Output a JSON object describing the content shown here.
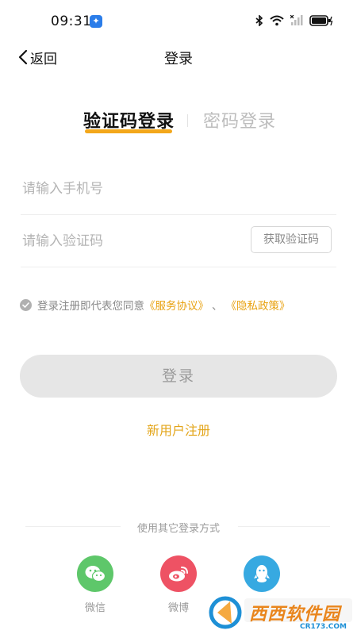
{
  "status_bar": {
    "time": "09:31"
  },
  "header": {
    "back_label": "返回",
    "title": "登录"
  },
  "tabs": [
    {
      "label": "验证码登录",
      "active": true
    },
    {
      "label": "密码登录",
      "active": false
    }
  ],
  "form": {
    "phone_placeholder": "请输入手机号",
    "code_placeholder": "请输入验证码",
    "get_code_label": "获取验证码"
  },
  "agreement": {
    "prefix": "登录注册即代表您同意",
    "service_link": "《服务协议》",
    "separator": "、",
    "privacy_link": "《隐私政策》"
  },
  "login_button": "登录",
  "register_link": "新用户注册",
  "other_login": {
    "label": "使用其它登录方式",
    "options": [
      {
        "label": "微信",
        "icon": "wechat-icon",
        "color": "#5ec76a"
      },
      {
        "label": "微博",
        "icon": "weibo-icon",
        "color": "#ee5264"
      },
      {
        "label": "",
        "icon": "qq-icon",
        "color": "#37a9e1"
      }
    ]
  },
  "watermark": {
    "brand": "西西软件园",
    "domain": "CR173.COM"
  },
  "colors": {
    "accent": "#f3a71b",
    "link": "#e8a10f",
    "disabled_button": "#e6e6e6"
  }
}
